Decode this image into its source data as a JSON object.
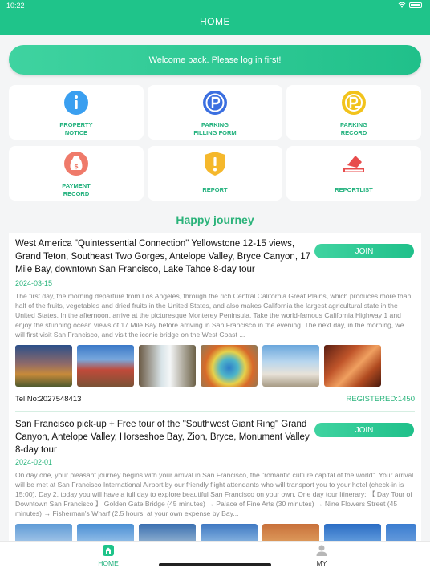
{
  "status": {
    "time": "10:22"
  },
  "header": {
    "title": "HOME"
  },
  "welcome": {
    "text": "Welcome back. Please log in first!"
  },
  "tiles": [
    {
      "line1": "PROPERTY",
      "line2": "NOTICE",
      "icon": "info-icon",
      "color": "#3a9ff0"
    },
    {
      "line1": "PARKING",
      "line2": "FILLING FORM",
      "icon": "parking-icon",
      "color": "#3b6fe0"
    },
    {
      "line1": "PARKING",
      "line2": "RECORD",
      "icon": "parking-record-icon",
      "color": "#f2c31c"
    },
    {
      "line1": "PAYMENT",
      "line2": "RECORD",
      "icon": "payment-bag-icon",
      "color": "#ef7a6a"
    },
    {
      "line1": "REPORT",
      "line2": "",
      "icon": "warning-shield-icon",
      "color": "#f5b82c"
    },
    {
      "line1": "REPORTLIST",
      "line2": "",
      "icon": "report-list-icon",
      "color": "#e84c4c"
    }
  ],
  "section_title": "Happy journey",
  "tours": [
    {
      "title": "West America \"Quintessential Connection\" Yellowstone 12-15 views, Grand Teton, Southeast Two Gorges, Antelope Valley, Bryce Canyon, 17 Mile Bay, downtown San Francisco, Lake Tahoe 8-day tour",
      "join": "JOIN",
      "date": "2024-03-15",
      "description": "The first day, the morning departure from Los Angeles, through the rich Central California Great Plains, which produces more than half of the fruits, vegetables and dried fruits in the United States, and also makes California the largest agricultural state in the United States. In the afternoon, arrive at the picturesque Monterey Peninsula. Take the world-famous California Highway 1 and enjoy the stunning ocean views of 17 Mile Bay before arriving in San Francisco in the evening. The next day, in the morning, we will first visit San Francisco, and visit the iconic bridge on the West Coast ...",
      "tel": "Tel No:2027548413",
      "registered": "REGISTERED:1450"
    },
    {
      "title": "San Francisco pick-up + Free tour of the \"Southwest Giant Ring\" Grand Canyon, Antelope Valley, Horseshoe Bay, Zion, Bryce, Monument Valley 8-day tour",
      "join": "JOIN",
      "date": "2024-02-01",
      "description": "On day one, your pleasant journey begins with your arrival in San Francisco, the \"romantic culture capital of the world\". Your arrival will be met at San Francisco International Airport by our friendly flight attendants who will transport you to your hotel (check-in is 15:00). Day 2, today you will have a full day to explore beautiful San Francisco on your own. One day tour Itinerary: 【 Day Tour of Downtown San Francisco 】 Golden Gate Bridge (45 minutes) → Palace of Fine Arts (30 minutes) → Nine Flowers Street (45 minutes) → Fisherman's Wharf (2.5 hours, at your own expense by Bay..."
    }
  ],
  "tabs": [
    {
      "label": "HOME",
      "active": true
    },
    {
      "label": "MY",
      "active": false
    }
  ],
  "colors": {
    "accent": "#1fc48a",
    "accent_text": "#27b37a"
  }
}
